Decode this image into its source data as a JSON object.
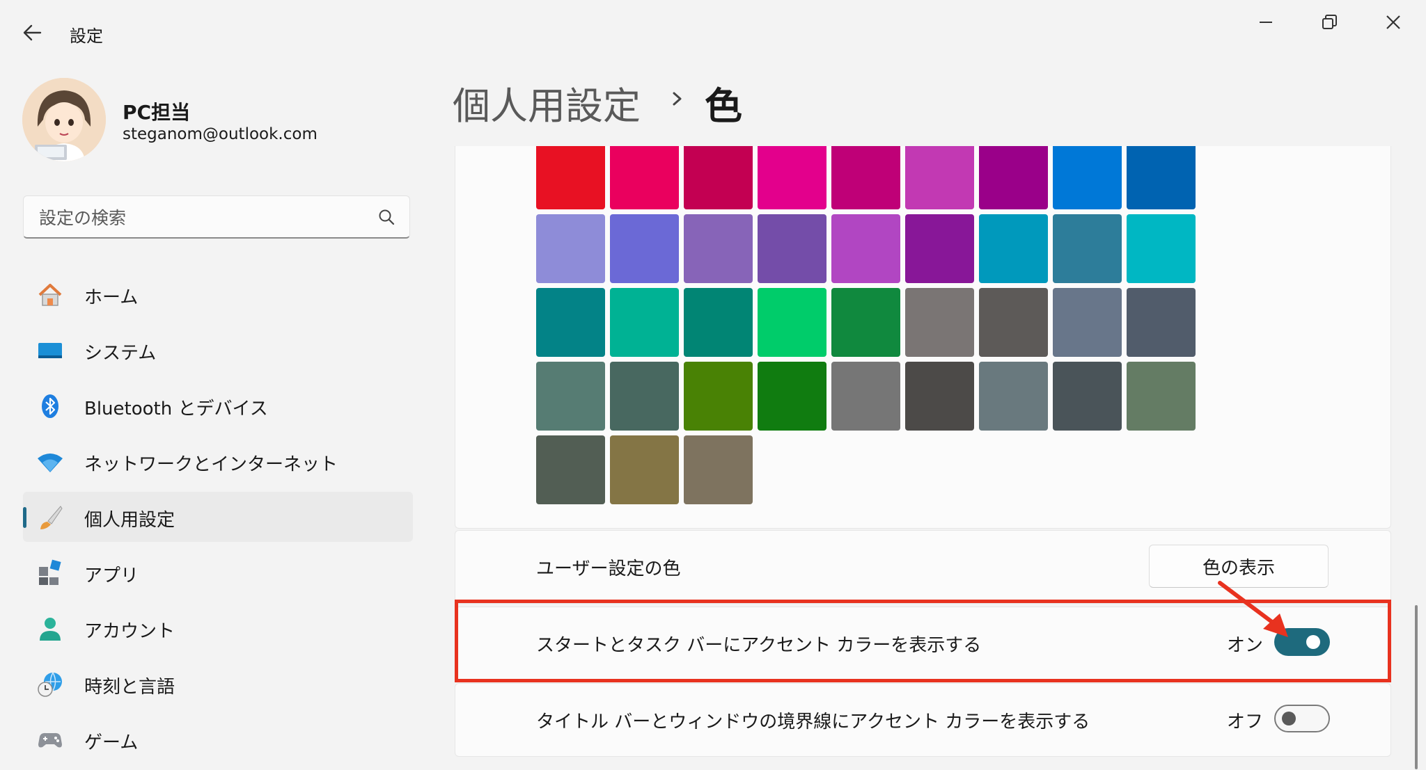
{
  "app": {
    "title": "設定"
  },
  "user": {
    "name": "PC担当",
    "email": "steganom@outlook.com"
  },
  "search": {
    "placeholder": "設定の検索"
  },
  "sidebar": {
    "items": [
      {
        "label": "ホーム",
        "icon": "home-icon"
      },
      {
        "label": "システム",
        "icon": "monitor-icon"
      },
      {
        "label": "Bluetooth とデバイス",
        "icon": "bluetooth-icon"
      },
      {
        "label": "ネットワークとインターネット",
        "icon": "wifi-icon"
      },
      {
        "label": "個人用設定",
        "icon": "brush-icon",
        "active": true
      },
      {
        "label": "アプリ",
        "icon": "apps-icon"
      },
      {
        "label": "アカウント",
        "icon": "person-icon"
      },
      {
        "label": "時刻と言語",
        "icon": "globe-clock-icon"
      },
      {
        "label": "ゲーム",
        "icon": "gamepad-icon"
      }
    ]
  },
  "breadcrumb": {
    "parent": "個人用設定",
    "current": "色"
  },
  "accent_colors": [
    "#e81123",
    "#ea005e",
    "#c30052",
    "#e3008c",
    "#bf0077",
    "#c239b3",
    "#9a0089",
    "#0078d7",
    "#0063b1",
    "#8e8cd8",
    "#6b69d6",
    "#8764b8",
    "#744da9",
    "#b146c2",
    "#881798",
    "#0099bc",
    "#2d7d9a",
    "#00b7c3",
    "#038387",
    "#00b294",
    "#018574",
    "#00cc6a",
    "#10893e",
    "#7a7574",
    "#5d5a58",
    "#68768a",
    "#515c6b",
    "#567c73",
    "#486860",
    "#498205",
    "#107c10",
    "#767676",
    "#4c4a48",
    "#69797e",
    "#4a5459",
    "#647c64",
    "#525e54",
    "#847545",
    "#7e735f"
  ],
  "settings": {
    "custom_color": {
      "label": "ユーザー設定の色",
      "button": "色の表示"
    },
    "accent_start": {
      "label": "スタートとタスク バーにアクセント カラーを表示する",
      "state": "オン",
      "on": true
    },
    "accent_title": {
      "label": "タイトル バーとウィンドウの境界線にアクセント カラーを表示する",
      "state": "オフ",
      "on": false
    }
  },
  "annotation": {
    "highlight_color": "#e8321f"
  },
  "colors": {
    "accent": "#1e6a7d"
  }
}
